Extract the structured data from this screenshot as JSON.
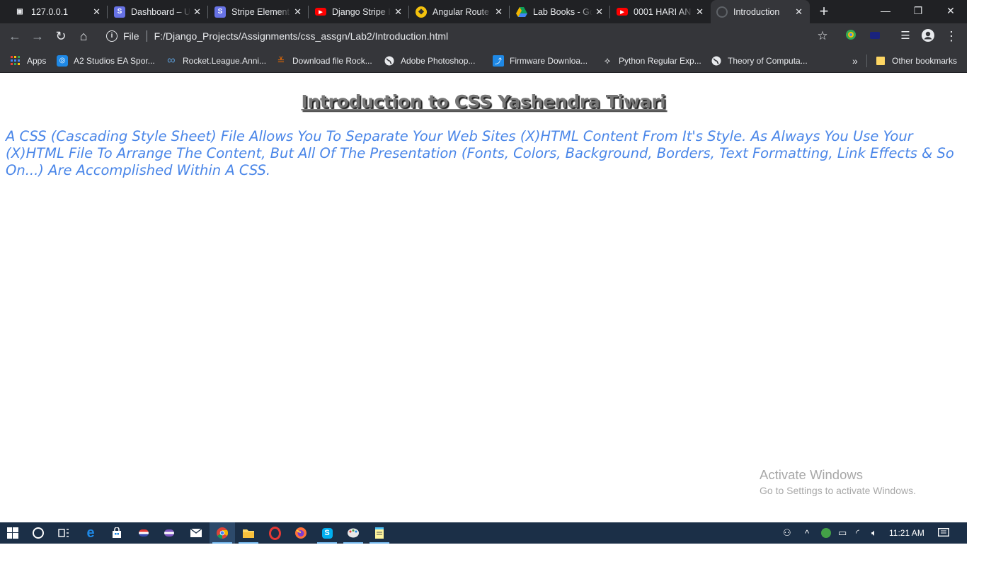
{
  "tabs": [
    {
      "title": "127.0.0.1",
      "icon": "computer-icon",
      "color": "#9aa0a6"
    },
    {
      "title": "Dashboard – U",
      "icon": "stripe-s-icon",
      "color": "#6772e5"
    },
    {
      "title": "Stripe Element",
      "icon": "stripe-s-icon",
      "color": "#6772e5"
    },
    {
      "title": "Django Stripe I",
      "icon": "youtube-icon",
      "color": "#ff0000"
    },
    {
      "title": "Angular Route",
      "icon": "angular-icon",
      "color": "#f4c20d"
    },
    {
      "title": "Lab Books - Gc",
      "icon": "google-drive-icon",
      "color": "#0f9d58"
    },
    {
      "title": "0001 HARI AN",
      "icon": "youtube-icon",
      "color": "#ff0000"
    },
    {
      "title": "Introduction",
      "icon": "globe-icon",
      "color": "#5f6368"
    }
  ],
  "address": {
    "protocol": "File",
    "url": "F:/Django_Projects/Assignments/css_assgn/Lab2/Introduction.html"
  },
  "bookmarks": [
    {
      "label": "Apps",
      "icon": "apps-grid-icon"
    },
    {
      "label": "A2 Studios EA Spor...",
      "icon": "a2-studios-icon"
    },
    {
      "label": "Rocket.League.Anni...",
      "icon": "infinity-icon"
    },
    {
      "label": "Download file Rock...",
      "icon": "download-icon"
    },
    {
      "label": "Adobe Photoshop...",
      "icon": "globe-icon"
    },
    {
      "label": "Firmware Downloa...",
      "icon": "firmware-icon"
    },
    {
      "label": "Python Regular Exp...",
      "icon": "python-icon"
    },
    {
      "label": "Theory of Computa...",
      "icon": "globe-icon"
    },
    {
      "label": "»",
      "icon": "chevron-more-icon"
    },
    {
      "label": "Other bookmarks",
      "icon": "folder-icon"
    }
  ],
  "page": {
    "heading": "Introduction to CSS Yashendra Tiwari",
    "paragraph": "A CSS (Cascading Style Sheet) File Allows You To Separate Your Web Sites (X)HTML Content From It's Style. As Always You Use Your (X)HTML File To Arrange The Content, But All Of The Presentation (Fonts, Colors, Background, Borders, Text Formatting, Link Effects & So On...) Are Accomplished Within A CSS."
  },
  "watermark": {
    "line1": "Activate Windows",
    "line2": "Go to Settings to activate Windows."
  },
  "taskbar": {
    "clock": "11:21 AM"
  },
  "colors": {
    "heading": "#777777",
    "paragraph": "#4a86e8",
    "taskbar": "#1b2f47",
    "browser_frame": "#202124"
  }
}
